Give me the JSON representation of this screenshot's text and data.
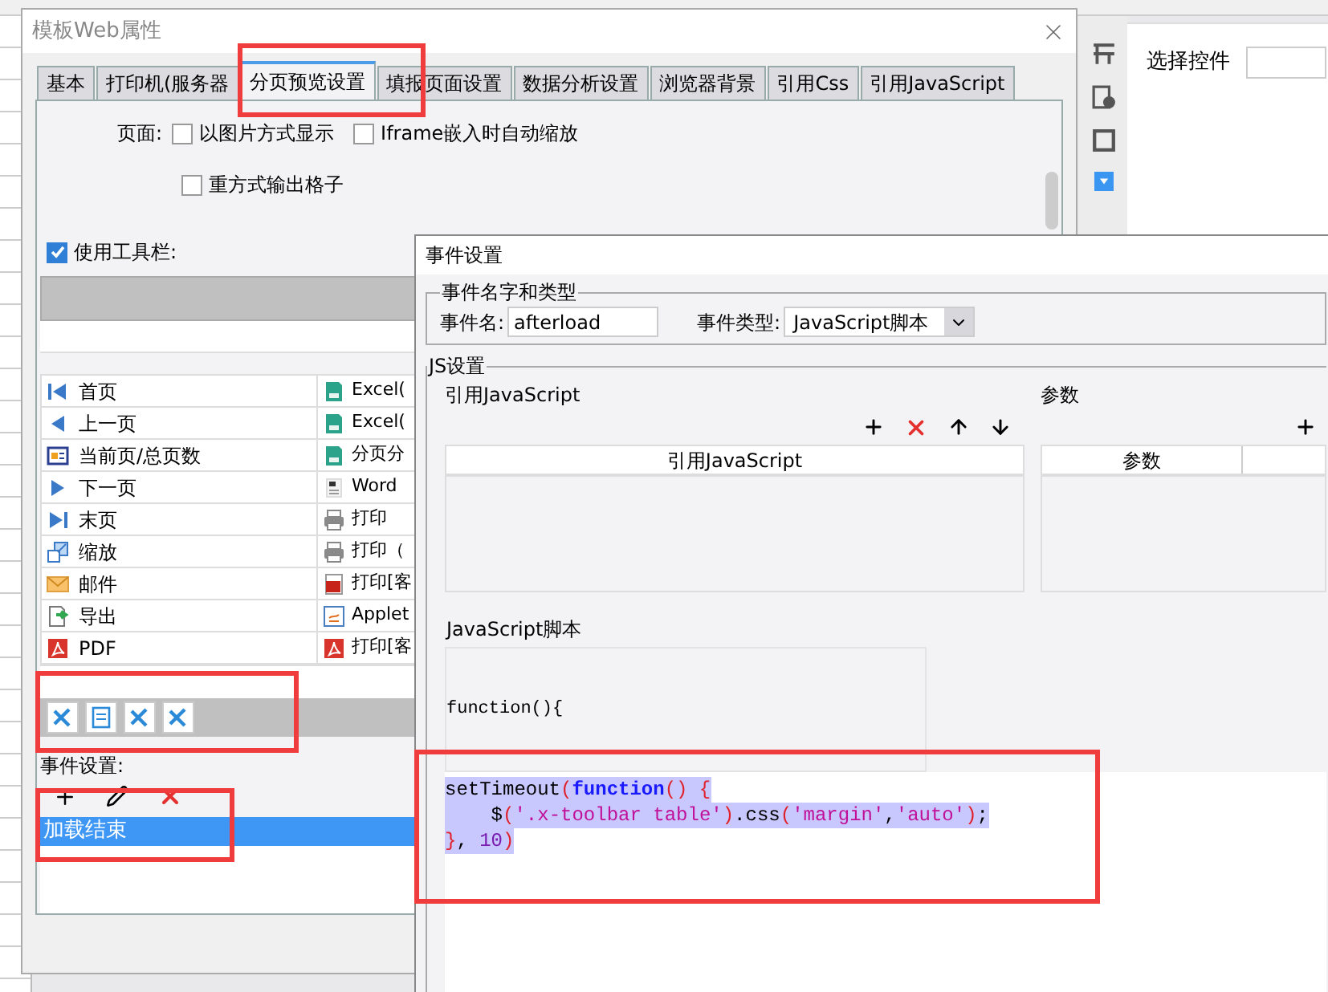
{
  "main_window": {
    "title": "模板Web属性",
    "tabs": [
      {
        "label": "基本",
        "selected": false
      },
      {
        "label": "打印机(服务器",
        "selected": false
      },
      {
        "label": "分页预览设置",
        "selected": true
      },
      {
        "label": "填报页面设置",
        "selected": false
      },
      {
        "label": "数据分析设置",
        "selected": false
      },
      {
        "label": "浏览器背景",
        "selected": false
      },
      {
        "label": "引用Css",
        "selected": false
      },
      {
        "label": "引用JavaScript",
        "selected": false
      }
    ],
    "page_label": "页面:",
    "options": [
      {
        "label": "以图片方式显示",
        "checked": false
      },
      {
        "label": "Iframe嵌入时自动缩放",
        "checked": false
      },
      {
        "label": "重方式输出格子",
        "checked": false
      }
    ],
    "use_toolbar": {
      "label": "使用工具栏:",
      "checked": true
    },
    "buttons": [
      {
        "left": {
          "label": "首页",
          "kind": "first"
        },
        "right": {
          "label": "Excel(",
          "kind": "excel"
        }
      },
      {
        "left": {
          "label": "上一页",
          "kind": "prev"
        },
        "right": {
          "label": "Excel(",
          "kind": "excel"
        }
      },
      {
        "left": {
          "label": "当前页/总页数",
          "kind": "count"
        },
        "right": {
          "label": "分页分",
          "kind": "excel"
        }
      },
      {
        "left": {
          "label": "下一页",
          "kind": "next"
        },
        "right": {
          "label": "Word",
          "kind": "word"
        }
      },
      {
        "left": {
          "label": "末页",
          "kind": "last"
        },
        "right": {
          "label": "打印",
          "kind": "print"
        }
      },
      {
        "left": {
          "label": "缩放",
          "kind": "zoom"
        },
        "right": {
          "label": "打印（",
          "kind": "print"
        }
      },
      {
        "left": {
          "label": "邮件",
          "kind": "mail"
        },
        "right": {
          "label": "打印[客",
          "kind": "flash"
        }
      },
      {
        "left": {
          "label": "导出",
          "kind": "export"
        },
        "right": {
          "label": "Applet",
          "kind": "applet"
        }
      },
      {
        "left": {
          "label": "PDF",
          "kind": "pdf"
        },
        "right": {
          "label": "打印[客",
          "kind": "pdf"
        }
      }
    ],
    "toolbar_items": [
      {
        "kind": "tools"
      },
      {
        "kind": "form"
      },
      {
        "kind": "tools"
      },
      {
        "kind": "tools"
      }
    ],
    "event_label": "事件设置:",
    "events": [
      {
        "label": "加载结束",
        "selected": true
      }
    ]
  },
  "right_panel": {
    "select_label": "选择控件"
  },
  "event_dialog": {
    "title": "事件设置",
    "group_name": "事件名字和类型",
    "name_label": "事件名:",
    "name_value": "afterload",
    "type_label": "事件类型:",
    "type_value": "JavaScript脚本",
    "js_group": "JS设置",
    "ref_title": "引用JavaScript",
    "ref_column": "引用JavaScript",
    "param_title": "参数",
    "param_column": "参数",
    "script_title": "JavaScript脚本",
    "function_header": "function(){",
    "code_lines": [
      [
        {
          "text": "setTimeout",
          "kind": "plain"
        },
        {
          "text": "(",
          "kind": "paren"
        },
        {
          "text": "function",
          "kind": "keyword"
        },
        {
          "text": "() {",
          "kind": "paren"
        }
      ],
      [
        {
          "text": "    $",
          "kind": "plain"
        },
        {
          "text": "(",
          "kind": "paren"
        },
        {
          "text": "'.x-toolbar table'",
          "kind": "string"
        },
        {
          "text": ")",
          "kind": "paren"
        },
        {
          "text": ".css",
          "kind": "plain"
        },
        {
          "text": "(",
          "kind": "paren"
        },
        {
          "text": "'margin'",
          "kind": "string"
        },
        {
          "text": ",",
          "kind": "plain"
        },
        {
          "text": "'auto'",
          "kind": "string"
        },
        {
          "text": ")",
          "kind": "paren"
        },
        {
          "text": ";",
          "kind": "plain"
        }
      ],
      [
        {
          "text": "}",
          "kind": "paren"
        },
        {
          "text": ", ",
          "kind": "plain"
        },
        {
          "text": "10",
          "kind": "number"
        },
        {
          "text": ")",
          "kind": "paren"
        }
      ]
    ]
  }
}
